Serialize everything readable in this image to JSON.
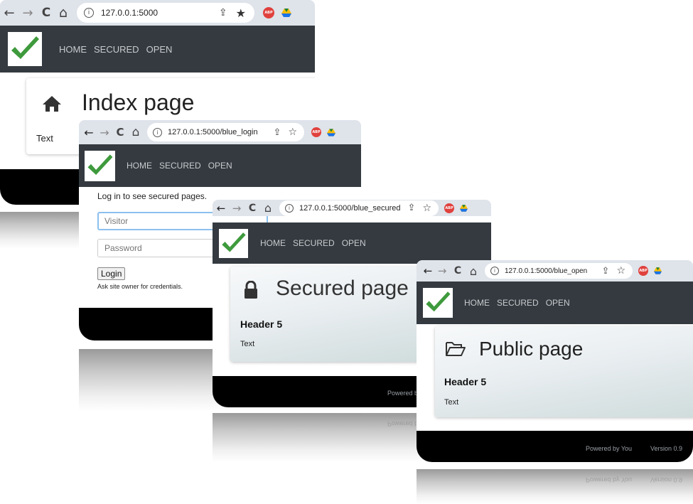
{
  "browser": {
    "nav_back": "←",
    "nav_forward": "→",
    "reload": "C",
    "home": "⌂",
    "info_icon": "i",
    "share_icon": "⇪",
    "star_icon": "★",
    "star_outline_icon": "☆",
    "abp_label": "ABP"
  },
  "windows": {
    "index": {
      "url": "127.0.0.1:5000",
      "nav": [
        "HOME",
        "SECURED",
        "OPEN"
      ],
      "page_title": "Index page",
      "body_text": "Text"
    },
    "login": {
      "url": "127.0.0.1:5000/blue_login",
      "nav": [
        "HOME",
        "SECURED",
        "OPEN"
      ],
      "intro": "Log in to see secured pages.",
      "username_value": "Visitor",
      "password_placeholder": "Password",
      "login_button": "Login",
      "hint": "Ask site owner for credentials."
    },
    "secured": {
      "url": "127.0.0.1:5000/blue_secured",
      "nav": [
        "HOME",
        "SECURED",
        "OPEN"
      ],
      "page_title": "Secured page",
      "header5": "Header 5",
      "body_text": "Text",
      "footer_powered": "Powered by You"
    },
    "open": {
      "url": "127.0.0.1:5000/blue_open",
      "nav": [
        "HOME",
        "SECURED",
        "OPEN"
      ],
      "page_title": "Public page",
      "header5": "Header 5",
      "body_text": "Text",
      "footer_powered": "Powered by You",
      "footer_version": "Version 0.9"
    }
  },
  "colors": {
    "navbar": "#343a40",
    "chrome_bar": "#dfe3ea",
    "check_green": "#3e9a3c",
    "footer": "#000000",
    "input_focus": "#8cc0ef"
  }
}
